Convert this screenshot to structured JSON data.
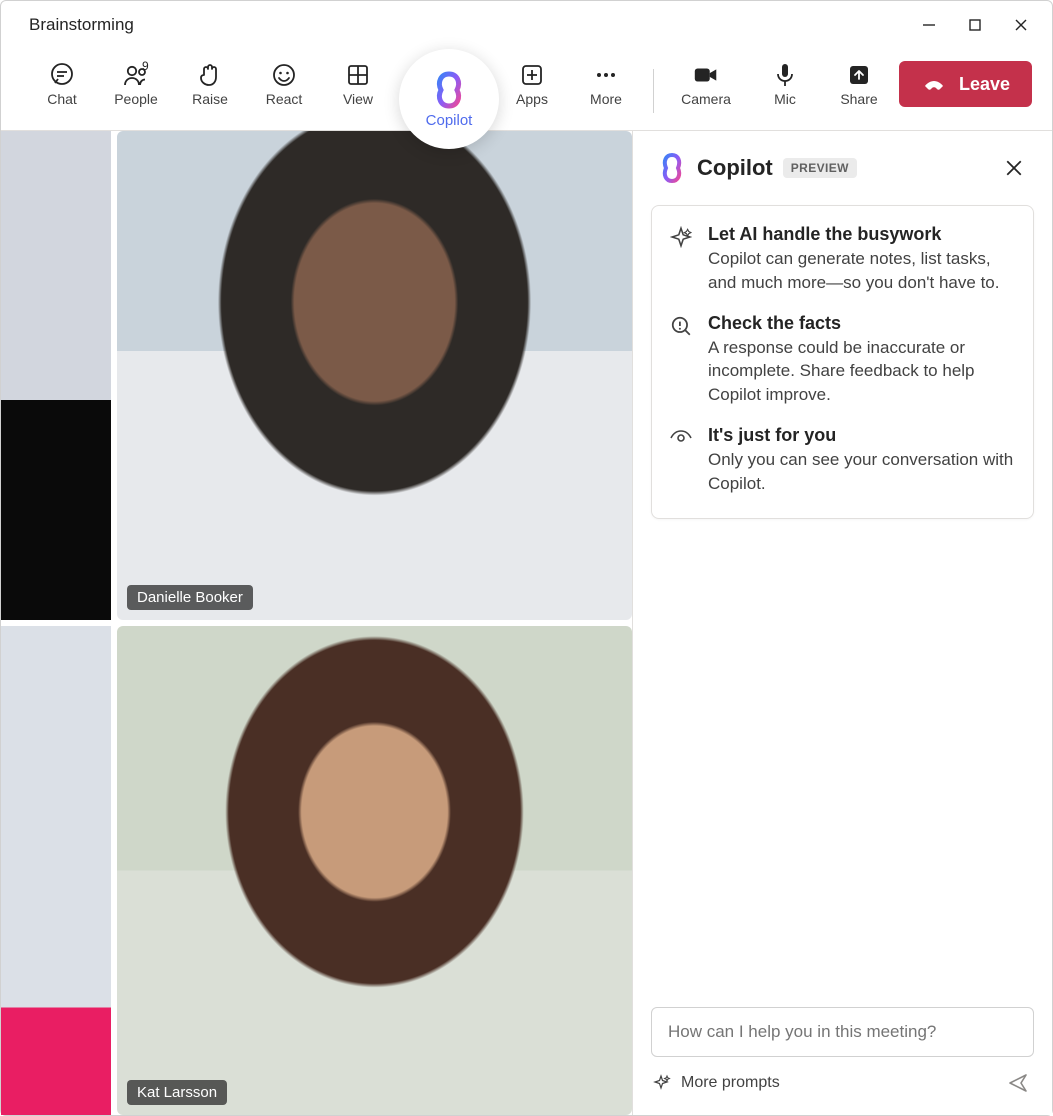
{
  "window": {
    "title": "Brainstorming"
  },
  "toolbar": {
    "chat": {
      "label": "Chat"
    },
    "people": {
      "label": "People",
      "count": "9"
    },
    "raise": {
      "label": "Raise"
    },
    "react": {
      "label": "React"
    },
    "view": {
      "label": "View"
    },
    "copilot": {
      "label": "Copilot"
    },
    "apps": {
      "label": "Apps"
    },
    "more": {
      "label": "More"
    },
    "camera": {
      "label": "Camera"
    },
    "mic": {
      "label": "Mic"
    },
    "share": {
      "label": "Share"
    },
    "leave": {
      "label": "Leave"
    }
  },
  "participants": [
    {
      "name": "Danielle Booker"
    },
    {
      "name": "Kat Larsson"
    }
  ],
  "copilot_panel": {
    "title": "Copilot",
    "badge": "PREVIEW",
    "blocks": [
      {
        "heading": "Let AI handle the busywork",
        "body": "Copilot can generate notes, list tasks, and much more—so you don't have to."
      },
      {
        "heading": "Check the facts",
        "body": "A response could be inaccurate or incomplete. Share feedback to help Copilot improve."
      },
      {
        "heading": "It's just for you",
        "body": "Only you can see your conversation with Copilot."
      }
    ],
    "input_placeholder": "How can I help you in this meeting?",
    "more_prompts": "More prompts"
  }
}
